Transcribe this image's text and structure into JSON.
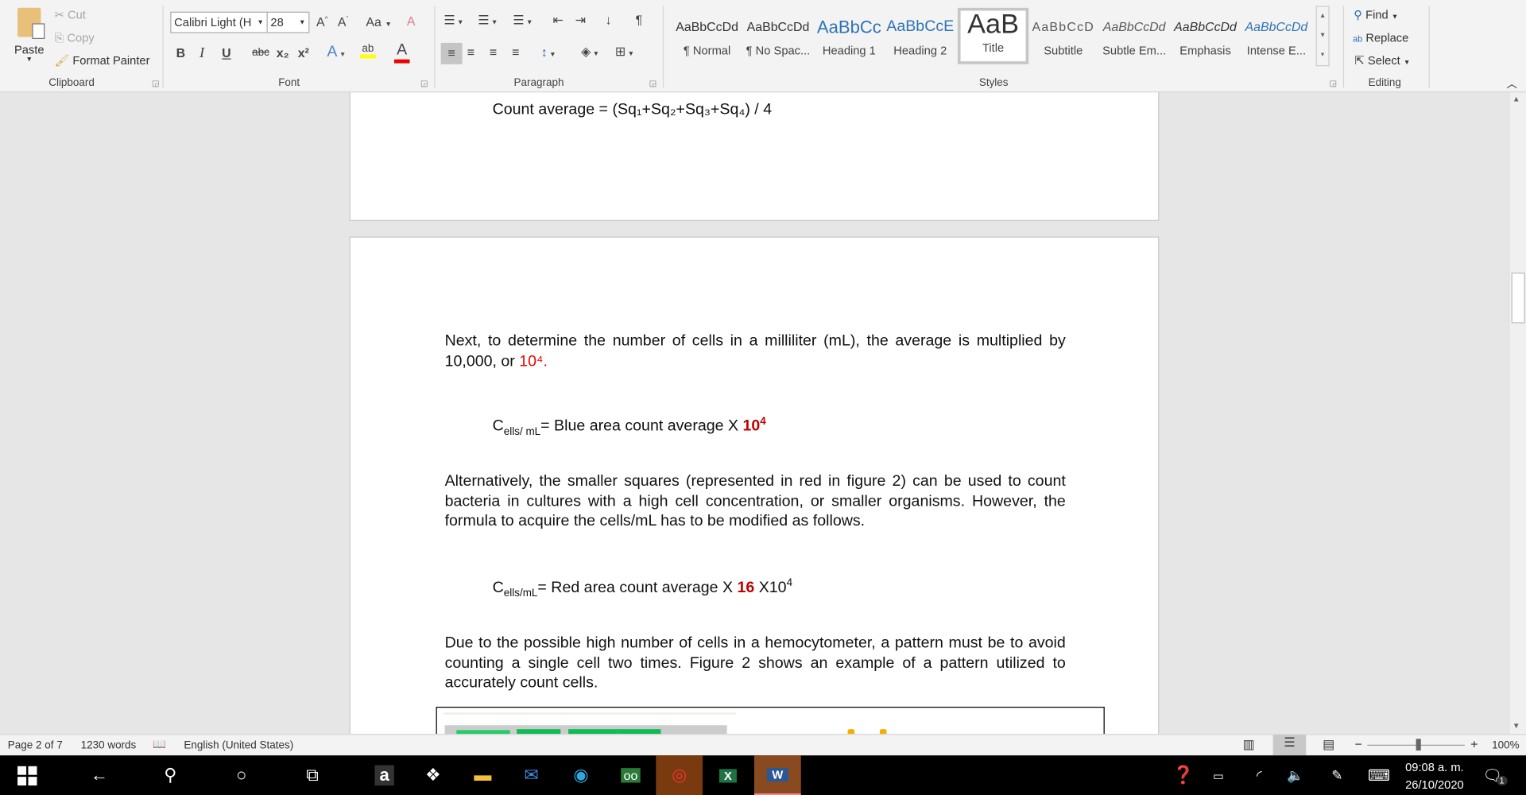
{
  "ribbon": {
    "clipboard": {
      "paste": "Paste",
      "cut": "Cut",
      "copy": "Copy",
      "format_painter": "Format Painter",
      "label": "Clipboard"
    },
    "font": {
      "name": "Calibri Light (H",
      "size": "28",
      "label": "Font",
      "case": "Aa",
      "bold": "B",
      "italic": "I",
      "underline": "U",
      "strike": "abc",
      "sub": "x₂",
      "sup": "x²"
    },
    "paragraph": {
      "label": "Paragraph"
    },
    "styles": {
      "label": "Styles",
      "items": [
        {
          "preview": "AaBbCcDd",
          "name": "¶ Normal"
        },
        {
          "preview": "AaBbCcDd",
          "name": "¶ No Spac..."
        },
        {
          "preview": "AaBbCc",
          "name": "Heading 1"
        },
        {
          "preview": "AaBbCcE",
          "name": "Heading 2"
        },
        {
          "preview": "AaB",
          "name": "Title"
        },
        {
          "preview": "AaBbCcD",
          "name": "Subtitle"
        },
        {
          "preview": "AaBbCcDd",
          "name": "Subtle Em..."
        },
        {
          "preview": "AaBbCcDd",
          "name": "Emphasis"
        },
        {
          "preview": "AaBbCcDd",
          "name": "Intense E..."
        }
      ]
    },
    "editing": {
      "find": "Find",
      "replace": "Replace",
      "select": "Select",
      "label": "Editing"
    }
  },
  "document": {
    "formula1": "Count average = (Sq₁+Sq₂+Sq₃+Sq₄) / 4",
    "para1": "Next, to determine the number of cells in a milliliter (mL), the average is multiplied by 10,000, or ",
    "para1_red": "10⁴.",
    "formula2": {
      "c": "C",
      "sub": "ells/ mL",
      "rest": "= Blue area count average X ",
      "red": "10",
      "sup": "4"
    },
    "para2": "Alternatively, the smaller squares (represented in red in figure 2) can be used to count bacteria in cultures with a high cell concentration, or smaller organisms. However, the formula to acquire the cells/mL has to be modified as follows.",
    "formula3": {
      "c": "C",
      "sub": "ells/mL",
      "rest": "= Red area count average X ",
      "red": "16",
      "tail": " X10",
      "sup": "4"
    },
    "para3": "Due to the possible high number of cells in a hemocytometer, a pattern must be to avoid counting a single cell two times. Figure 2 shows an example of a pattern utilized to accurately count cells."
  },
  "status": {
    "page": "Page 2 of 7",
    "words": "1230 words",
    "language": "English (United States)",
    "zoom": "100%",
    "zoom_level": 100
  },
  "taskbar": {
    "time": "09:08 a. m.",
    "date": "26/10/2020",
    "notifications": "1"
  }
}
